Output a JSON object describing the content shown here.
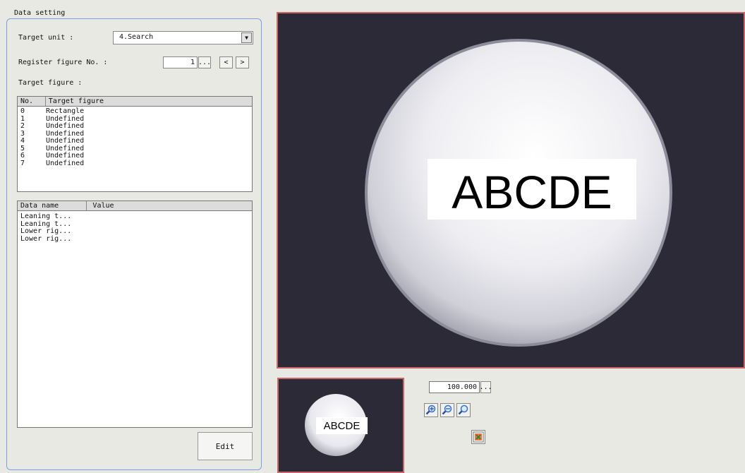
{
  "data_setting": {
    "group_title": "Data setting",
    "target_unit_label": "Target unit :",
    "target_unit_value": "4.Search",
    "register_figure_label": "Register figure No. :",
    "register_figure_value": "1",
    "register_browse": "...",
    "prev": "<",
    "next": ">",
    "target_figure_label": "Target figure :"
  },
  "figure_list": {
    "columns": [
      "No.",
      "Target figure"
    ],
    "rows": [
      {
        "no": "0",
        "figure": "Rectangle"
      },
      {
        "no": "1",
        "figure": "Undefined"
      },
      {
        "no": "2",
        "figure": "Undefined"
      },
      {
        "no": "3",
        "figure": "Undefined"
      },
      {
        "no": "4",
        "figure": "Undefined"
      },
      {
        "no": "5",
        "figure": "Undefined"
      },
      {
        "no": "6",
        "figure": "Undefined"
      },
      {
        "no": "7",
        "figure": "Undefined"
      }
    ]
  },
  "data_list": {
    "columns": [
      "Data name",
      "Value"
    ],
    "rows": [
      {
        "name": "Leaning t...",
        "value": ""
      },
      {
        "name": "Leaning t...",
        "value": ""
      },
      {
        "name": "Lower rig...",
        "value": ""
      },
      {
        "name": "Lower rig...",
        "value": ""
      }
    ]
  },
  "edit_button": "Edit",
  "image": {
    "main_text": "ABCDE",
    "thumb_text": "ABCDE"
  },
  "zoom": {
    "value": "100.000",
    "browse": "...",
    "zoom_in_icon": "zoom-in-icon",
    "zoom_out_icon": "zoom-out-icon",
    "zoom_fit_icon": "zoom-fit-icon",
    "fit_window_icon": "fit-window-icon"
  },
  "colors": {
    "group_border": "#7d9ee8",
    "image_border": "#cc6666",
    "image_bg": "#2c2a36"
  }
}
